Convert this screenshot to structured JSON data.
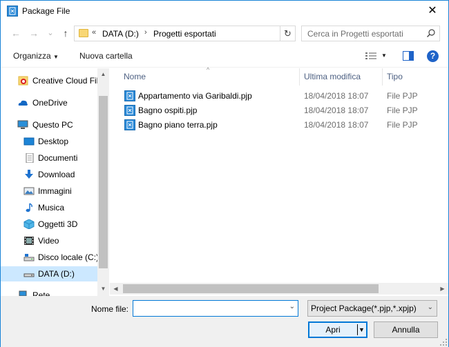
{
  "window": {
    "title": "Package File",
    "close_glyph": "✕"
  },
  "nav": {
    "back_glyph": "←",
    "forward_glyph": "→",
    "recent_glyph": "⌄",
    "up_glyph": "↑",
    "address": {
      "overflow": "«",
      "crumbs": [
        "DATA (D:)",
        "Progetti esportati"
      ],
      "sep_glyph": "›",
      "refresh_glyph": "↻"
    },
    "search": {
      "placeholder": "Cerca in Progetti esportati",
      "icon": "search-icon"
    }
  },
  "toolbar": {
    "organize_label": "Organizza",
    "new_folder_label": "Nuova cartella",
    "view_icon": "view-details-icon",
    "preview_icon": "preview-pane-icon",
    "help_glyph": "?"
  },
  "sidebar": {
    "items": [
      {
        "label": "Creative Cloud Fil",
        "icon": "creative-cloud-icon",
        "selected": false
      },
      {
        "label": "OneDrive",
        "icon": "onedrive-icon",
        "selected": false
      },
      {
        "label": "Questo PC",
        "icon": "computer-icon",
        "selected": false
      },
      {
        "label": "Desktop",
        "icon": "desktop-icon",
        "selected": false
      },
      {
        "label": "Documenti",
        "icon": "documents-icon",
        "selected": false
      },
      {
        "label": "Download",
        "icon": "download-icon",
        "selected": false
      },
      {
        "label": "Immagini",
        "icon": "pictures-icon",
        "selected": false
      },
      {
        "label": "Musica",
        "icon": "music-icon",
        "selected": false
      },
      {
        "label": "Oggetti 3D",
        "icon": "objects-3d-icon",
        "selected": false
      },
      {
        "label": "Video",
        "icon": "video-icon",
        "selected": false
      },
      {
        "label": "Disco locale (C:)",
        "icon": "drive-icon",
        "selected": false
      },
      {
        "label": "DATA (D:)",
        "icon": "drive-icon",
        "selected": true
      },
      {
        "label": "Rete",
        "icon": "network-icon",
        "selected": false
      }
    ]
  },
  "file_list": {
    "columns": [
      "Nome",
      "Ultima modifica",
      "Tipo"
    ],
    "sort_glyph": "^",
    "rows": [
      {
        "name": "Appartamento via Garibaldi.pjp",
        "modified": "18/04/2018 18:07",
        "type": "File PJP"
      },
      {
        "name": "Bagno ospiti.pjp",
        "modified": "18/04/2018 18:07",
        "type": "File PJP"
      },
      {
        "name": "Bagno piano terra.pjp",
        "modified": "18/04/2018 18:07",
        "type": "File PJP"
      }
    ]
  },
  "footer": {
    "filename_label": "Nome file:",
    "filename_value": "",
    "filter_value": "Project Package(*.pjp,*.xpjp)",
    "open_label": "Apri",
    "cancel_label": "Annulla",
    "dropdown_glyph": "⌄"
  },
  "colors": {
    "accent": "#0078d7",
    "selected_bg": "#cce8ff",
    "chrome": "#f0f0f0",
    "help": "#1f63c8"
  }
}
